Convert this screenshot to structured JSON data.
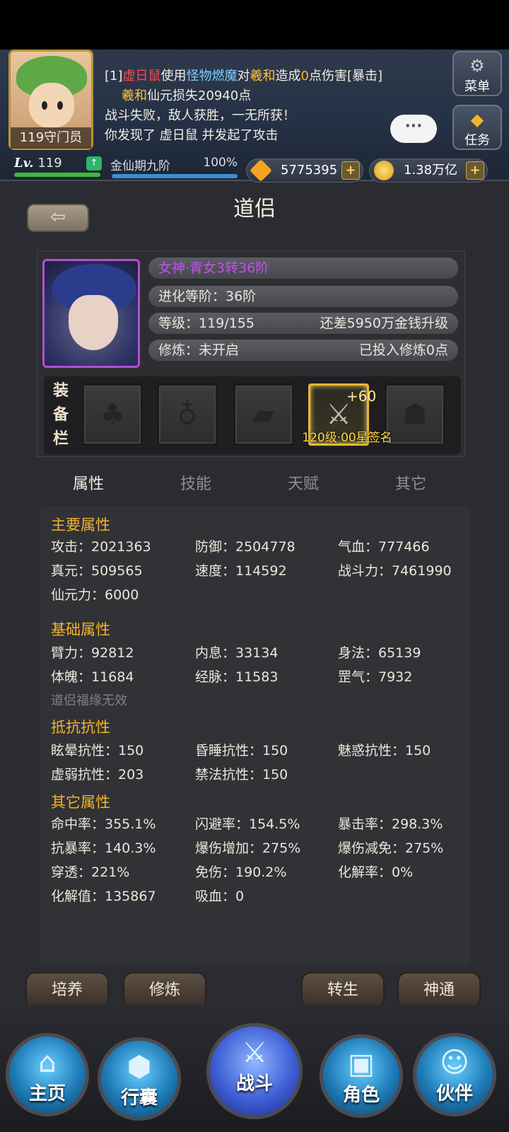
{
  "header": {
    "avatar_label": "119守门员",
    "log": {
      "line1": {
        "prefix": "[1]",
        "enemy": "虚日鼠",
        "use": "使用",
        "skill": "怪物燃魔",
        "to": "对",
        "target": "羲和",
        "hit": "造成",
        "damage": "0",
        "suffix": "点伤害[暴击]"
      },
      "line2": {
        "name": "羲和",
        "text": "仙元损失20940点"
      },
      "line3": "战斗失败，敌人获胜，一无所获！",
      "line4": "你发现了 虚日鼠 并发起了攻击"
    },
    "chat_icon": "···",
    "menu_label": "菜单",
    "task_label": "任务",
    "level_prefix": "Lv.",
    "level_value": "119",
    "realm_label": "金仙期九阶",
    "realm_percent": "100%",
    "gems": "5775395",
    "gold": "1.38万亿",
    "plus": "+"
  },
  "page": {
    "title": "道侣",
    "back_icon": "arrow-left-icon"
  },
  "partner": {
    "name": "女神·青女3转36阶",
    "evolution": "进化等阶：36阶",
    "level": "等级：119/155",
    "level_need": "还差5950万金钱升级",
    "cultivation": "修炼：未开启",
    "cultivation_invested": "已投入修炼0点",
    "equip_label": [
      "装",
      "备",
      "栏"
    ],
    "equipped_plus": "+60",
    "equipped_caption": "120级·00星签名"
  },
  "tabs": [
    "属性",
    "技能",
    "天赋",
    "其它"
  ],
  "stats": {
    "main_title": "主要属性",
    "main": [
      "攻击：2021363",
      "防御：2504778",
      "气血：777466",
      "真元：509565",
      "速度：114592",
      "战斗力：7461990",
      "仙元力：6000"
    ],
    "base_title": "基础属性",
    "base": [
      "臂力：92812",
      "内息：33134",
      "身法：65139",
      "体魄：11684",
      "经脉：11583",
      "罡气：7932"
    ],
    "base_note": "道侣福缘无效",
    "resist_title": "抵抗抗性",
    "resist": [
      "眩晕抗性：150",
      "昏睡抗性：150",
      "魅惑抗性：150",
      "虚弱抗性：203",
      "禁法抗性：150"
    ],
    "other_title": "其它属性",
    "other": [
      "命中率：355.1%",
      "闪避率：154.5%",
      "暴击率：298.3%",
      "抗暴率：140.3%",
      "爆伤增加：275%",
      "爆伤减免：275%",
      "穿透：221%",
      "免伤：190.2%",
      "化解率：0%",
      "化解值：135867",
      "吸血：0"
    ]
  },
  "actions": [
    "培养",
    "修炼",
    "转生",
    "神通"
  ],
  "nav": [
    "主页",
    "行囊",
    "战斗",
    "角色",
    "伙伴"
  ],
  "colors": {
    "accent_gold": "#f4b32c",
    "purple_name": "#c44ef2",
    "enemy_red": "#ff4a4a",
    "skill_blue": "#7fd0ff"
  }
}
